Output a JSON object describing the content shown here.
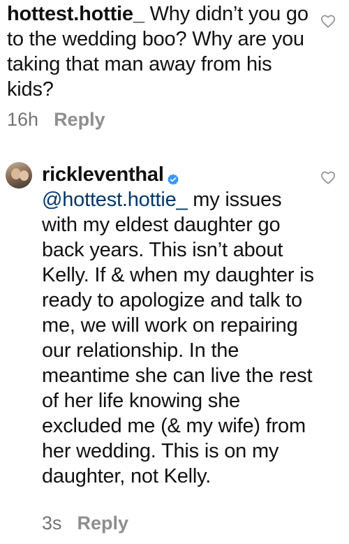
{
  "comments": [
    {
      "username": "hottest.hottie_",
      "text": " Why didn’t you go to the wedding boo? Why are you taking that man away from his kids?",
      "time": "16h",
      "reply_label": "Reply",
      "verified": false
    },
    {
      "username": "rickleventhal",
      "verified": true,
      "mention": "@hottest.hottie_",
      "text": " my issues with my eldest daughter go back years.  This isn’t about Kelly.  If & when my daughter is ready to apologize and talk to me, we will work on repairing our relationship. In the meantime she can live the rest of her life knowing she excluded me (& my wife) from her wedding. This is on my daughter, not Kelly.",
      "time": "3s",
      "reply_label": "Reply"
    }
  ],
  "icons": {
    "like": "heart-outline-icon",
    "verified": "verified-badge-icon"
  },
  "colors": {
    "text": "#111111",
    "meta": "#8e8e8e",
    "verified": "#3897f0",
    "mention": "#00376b"
  }
}
